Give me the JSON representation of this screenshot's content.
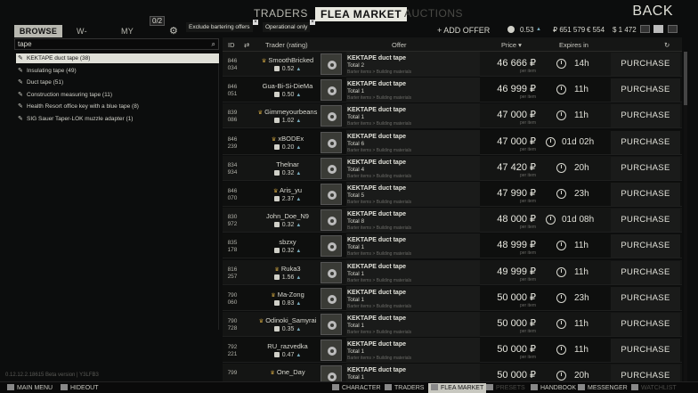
{
  "nav": {
    "traders": "TRADERS",
    "flea": "FLEA MARKET",
    "auctions": "AUCTIONS",
    "back": "BACK"
  },
  "subtabs": {
    "browse": "BROWSE",
    "wlist": "W-LIST",
    "my_offers": "MY OFFERS",
    "offers_count": "0/2"
  },
  "filters": {
    "barter": "Exclude bartering offers",
    "operational": "Operational only"
  },
  "actions": {
    "add_offer": "+ ADD OFFER"
  },
  "balance": {
    "rating": "0.53",
    "rub": "₽ 651 579",
    "eur": "€ 554",
    "usd": "$ 1 472"
  },
  "search": {
    "value": "tape"
  },
  "results": [
    {
      "label": "KEKTAPE duct tape (38)",
      "selected": true
    },
    {
      "label": "Insulating tape (49)"
    },
    {
      "label": "Duct tape (51)"
    },
    {
      "label": "Construction measuring tape (11)"
    },
    {
      "label": "Health Resort office key with a blue tape (8)"
    },
    {
      "label": "SIG Sauer Taper-LOK muzzle adapter (1)"
    }
  ],
  "table_headers": {
    "id": "ID",
    "trader": "Trader (rating)",
    "offer": "Offer",
    "price": "Price",
    "expires": "Expires in"
  },
  "offers": [
    {
      "id1": "846",
      "id2": "034",
      "trader": "SmoothBricked",
      "crown": true,
      "rating": "0.52",
      "item": "KEKTAPE duct tape",
      "total": "Total 2",
      "category": "Barter items > Building materials",
      "price": "46 666 ₽",
      "per": "per item",
      "expires": "14h",
      "buy": "PURCHASE"
    },
    {
      "id1": "846",
      "id2": "051",
      "trader": "Gua-Bi-Si-DieMa",
      "crown": false,
      "rating": "0.50",
      "item": "KEKTAPE duct tape",
      "total": "Total 1",
      "category": "Barter items > Building materials",
      "price": "46 999 ₽",
      "per": "per item",
      "expires": "11h",
      "buy": "PURCHASE"
    },
    {
      "id1": "839",
      "id2": "086",
      "trader": "Gimmeyourbeans",
      "crown": true,
      "rating": "1.02",
      "item": "KEKTAPE duct tape",
      "total": "Total 1",
      "category": "Barter items > Building materials",
      "price": "47 000 ₽",
      "per": "per item",
      "expires": "11h",
      "buy": "PURCHASE"
    },
    {
      "id1": "846",
      "id2": "239",
      "trader": "xBODEx",
      "crown": true,
      "rating": "0.20",
      "item": "KEKTAPE duct tape",
      "total": "Total 6",
      "category": "Barter items > Building materials",
      "price": "47 000 ₽",
      "per": "per item",
      "expires": "01d 02h",
      "buy": "PURCHASE"
    },
    {
      "id1": "834",
      "id2": "934",
      "trader": "Thelnar",
      "crown": false,
      "rating": "0.32",
      "item": "KEKTAPE duct tape",
      "total": "Total 4",
      "category": "Barter items > Building materials",
      "price": "47 420 ₽",
      "per": "per item",
      "expires": "20h",
      "buy": "PURCHASE"
    },
    {
      "id1": "846",
      "id2": "070",
      "trader": "Aris_yu",
      "crown": true,
      "rating": "2.37",
      "item": "KEKTAPE duct tape",
      "total": "Total 5",
      "category": "Barter items > Building materials",
      "price": "47 990 ₽",
      "per": "per item",
      "expires": "23h",
      "buy": "PURCHASE"
    },
    {
      "id1": "830",
      "id2": "972",
      "trader": "John_Doe_N9",
      "crown": false,
      "rating": "0.32",
      "item": "KEKTAPE duct tape",
      "total": "Total 8",
      "category": "Barter items > Building materials",
      "price": "48 000 ₽",
      "per": "per item",
      "expires": "01d 08h",
      "buy": "PURCHASE"
    },
    {
      "id1": "835",
      "id2": "178",
      "trader": "sbzxy",
      "crown": false,
      "rating": "0.32",
      "item": "KEKTAPE duct tape",
      "total": "Total 1",
      "category": "Barter items > Building materials",
      "price": "48 999 ₽",
      "per": "per item",
      "expires": "11h",
      "buy": "PURCHASE"
    },
    {
      "id1": "816",
      "id2": "257",
      "trader": "Ruka3",
      "crown": true,
      "rating": "1.56",
      "item": "KEKTAPE duct tape",
      "total": "Total 1",
      "category": "Barter items > Building materials",
      "price": "49 999 ₽",
      "per": "per item",
      "expires": "11h",
      "buy": "PURCHASE"
    },
    {
      "id1": "790",
      "id2": "060",
      "trader": "Ma-Zong",
      "crown": true,
      "rating": "0.83",
      "item": "KEKTAPE duct tape",
      "total": "Total 1",
      "category": "Barter items > Building materials",
      "price": "50 000 ₽",
      "per": "per item",
      "expires": "23h",
      "buy": "PURCHASE"
    },
    {
      "id1": "790",
      "id2": "728",
      "trader": "Odinoki_Samyrai",
      "crown": true,
      "rating": "0.35",
      "item": "KEKTAPE duct tape",
      "total": "Total 1",
      "category": "Barter items > Building materials",
      "price": "50 000 ₽",
      "per": "per item",
      "expires": "11h",
      "buy": "PURCHASE"
    },
    {
      "id1": "792",
      "id2": "221",
      "trader": "RU_razvedka",
      "crown": false,
      "rating": "0.47",
      "item": "KEKTAPE duct tape",
      "total": "Total 1",
      "category": "Barter items > Building materials",
      "price": "50 000 ₽",
      "per": "per item",
      "expires": "11h",
      "buy": "PURCHASE"
    },
    {
      "id1": "799",
      "id2": "",
      "trader": "One_Day",
      "crown": true,
      "rating": "",
      "item": "KEKTAPE duct tape",
      "total": "Total 1",
      "category": "",
      "price": "50 000 ₽",
      "per": "",
      "expires": "20h",
      "buy": "PURCHASE"
    }
  ],
  "version": "0.12.12.2.18615 Beta version | Y3LFB3",
  "bottom": {
    "main_menu": "MAIN MENU",
    "hideout": "HIDEOUT",
    "character": "CHARACTER",
    "traders": "TRADERS",
    "flea": "FLEA MARKET",
    "presets": "PRESETS",
    "handbook": "HANDBOOK",
    "messenger": "MESSENGER",
    "watchlist": "WATCHLIST"
  }
}
